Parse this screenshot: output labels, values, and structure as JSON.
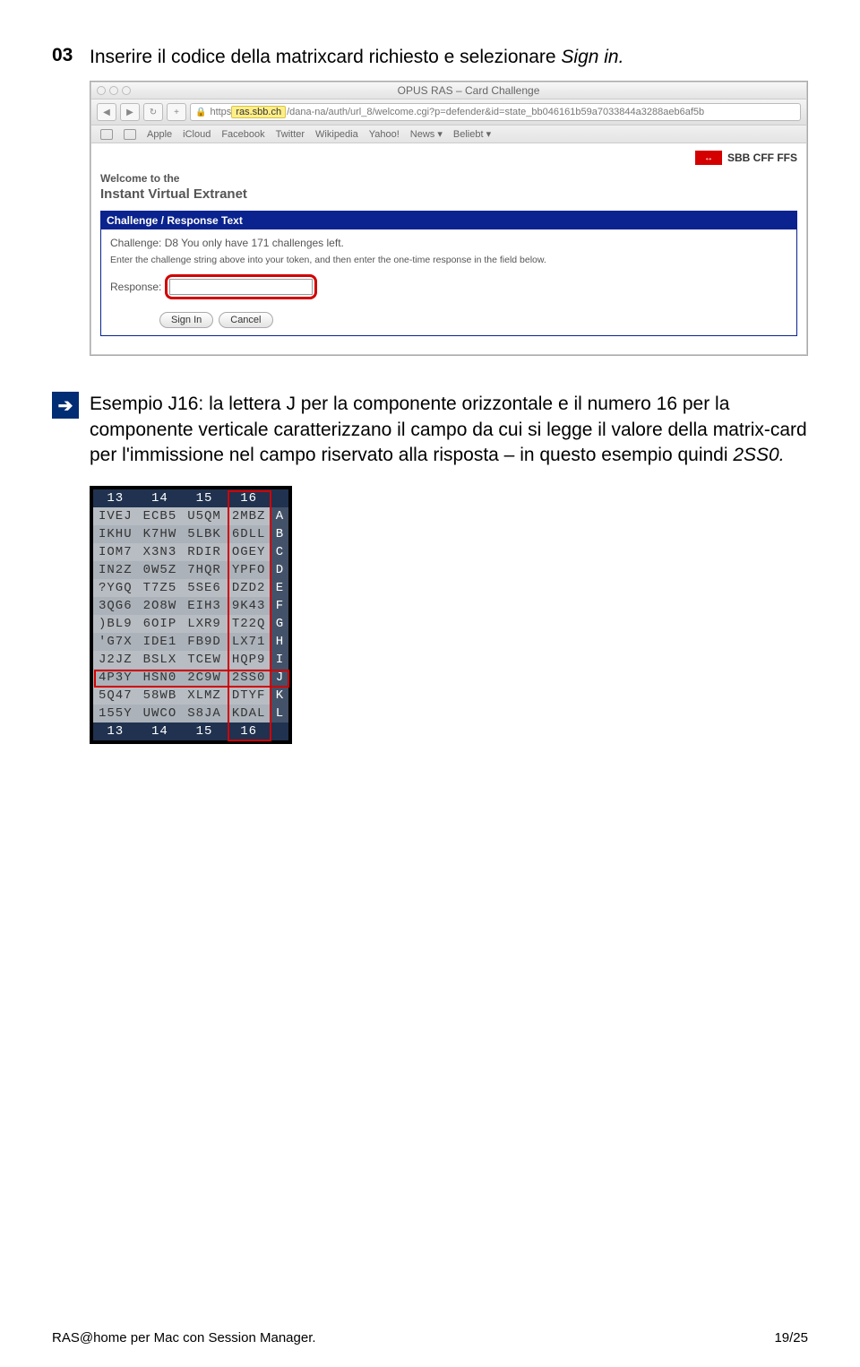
{
  "step": {
    "number": "03",
    "text_before": "Inserire il codice della matrixcard richiesto e selezionare ",
    "text_italic": "Sign in."
  },
  "browser": {
    "title": "OPUS RAS – Card Challenge",
    "back": "◀",
    "fwd": "▶",
    "reload": "↻",
    "plus": "+",
    "url_prefix": "https ",
    "url_highlight": "ras.sbb.ch",
    "url_rest": "/dana-na/auth/url_8/welcome.cgi?p=defender&id=state_bb046161b59a7033844a3288aeb6af5b",
    "bookmarks": [
      "Apple",
      "iCloud",
      "Facebook",
      "Twitter",
      "Wikipedia",
      "Yahoo!",
      "News ▾",
      "Beliebt ▾"
    ],
    "sbb_logo_glyph": "↔",
    "sbb_text": "SBB CFF FFS",
    "welcome1": "Welcome to the",
    "welcome2": "Instant Virtual Extranet",
    "challenge_head": "Challenge / Response Text",
    "challenge_line1": "Challenge: D8 You only have 171 challenges left.",
    "challenge_line2": "Enter the challenge string above into your token, and then enter the one-time response in the field below.",
    "response_label": "Response:",
    "btn_signin": "Sign In",
    "btn_cancel": "Cancel"
  },
  "arrow_glyph": "➔",
  "example": {
    "p1": "Esempio J16: la lettera J per la componente orizzontale e il numero 16 per la componente verticale caratterizzano il campo da cui si legge il valore della matrix-card per l'immissione nel campo riservato alla risposta – in questo esempio quindi ",
    "p1_ital": "2SS0."
  },
  "matrix": {
    "cols_top": [
      "13",
      "14",
      "15",
      "16"
    ],
    "rows": [
      {
        "label": "A",
        "cells": [
          "IVEJ",
          "ECB5",
          "U5QM",
          "2MBZ"
        ]
      },
      {
        "label": "B",
        "cells": [
          "IKHU",
          "K7HW",
          "5LBK",
          "6DLL"
        ]
      },
      {
        "label": "C",
        "cells": [
          "IOM7",
          "X3N3",
          "RDIR",
          "OGEY"
        ]
      },
      {
        "label": "D",
        "cells": [
          "IN2Z",
          "0W5Z",
          "7HQR",
          "YPFO"
        ]
      },
      {
        "label": "E",
        "cells": [
          "?YGQ",
          "T7Z5",
          "5SE6",
          "DZD2"
        ]
      },
      {
        "label": "F",
        "cells": [
          "3QG6",
          "2O8W",
          "EIH3",
          "9K43"
        ]
      },
      {
        "label": "G",
        "cells": [
          ")BL9",
          "6OIP",
          "LXR9",
          "T22Q"
        ]
      },
      {
        "label": "H",
        "cells": [
          "'G7X",
          "IDE1",
          "FB9D",
          "LX71"
        ]
      },
      {
        "label": "I",
        "cells": [
          "J2JZ",
          "BSLX",
          "TCEW",
          "HQP9"
        ]
      },
      {
        "label": "J",
        "cells": [
          "4P3Y",
          "HSN0",
          "2C9W",
          "2SS0"
        ]
      },
      {
        "label": "K",
        "cells": [
          "5Q47",
          "58WB",
          "XLMZ",
          "DTYF"
        ]
      },
      {
        "label": "L",
        "cells": [
          "155Y",
          "UWCO",
          "S8JA",
          "KDAL"
        ]
      }
    ],
    "cols_bottom": [
      "13",
      "14",
      "15",
      "16"
    ]
  },
  "footer": {
    "left": "RAS@home per Mac con Session Manager.",
    "right": "19/25"
  }
}
